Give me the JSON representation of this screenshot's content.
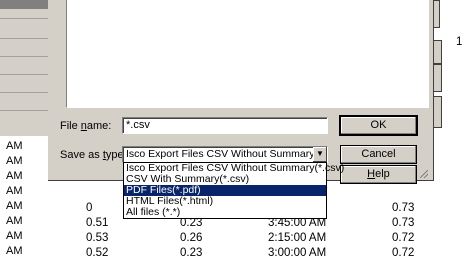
{
  "background": {
    "left_col": [
      "AM",
      "AM",
      "AM",
      "AM",
      "AM",
      "AM",
      "AM",
      "AM"
    ],
    "right_number": "1",
    "rows": [
      {
        "c1": "0",
        "c2": "",
        "c3": "",
        "c4": "0.73"
      },
      {
        "c1": "0.51",
        "c2": "0.23",
        "c3": "3:45:00 AM",
        "c4": "0.73"
      },
      {
        "c1": "0.53",
        "c2": "0.26",
        "c3": "2:15:00 AM",
        "c4": "0.72"
      },
      {
        "c1": "0.52",
        "c2": "0.23",
        "c3": "3:00:00 AM",
        "c4": "0.72"
      }
    ]
  },
  "dialog": {
    "file_name_label_pre": "File ",
    "file_name_label_key": "n",
    "file_name_label_post": "ame:",
    "file_name_value": "*.csv",
    "save_as_label_pre": "Save as ",
    "save_as_label_key": "t",
    "save_as_label_post": "ype:",
    "save_as_value": "Isco Export Files CSV Without Summary(*.cs",
    "ok_label": "OK",
    "cancel_label": "Cancel",
    "help_label_key": "H",
    "help_label_post": "elp",
    "options": [
      "Isco Export Files CSV Without Summary(*.csv)",
      "CSV With Summary(*.csv)",
      "PDF Files(*.pdf)",
      "HTML Files(*.html)",
      "All files (*.*)"
    ],
    "selected_option": 2
  }
}
